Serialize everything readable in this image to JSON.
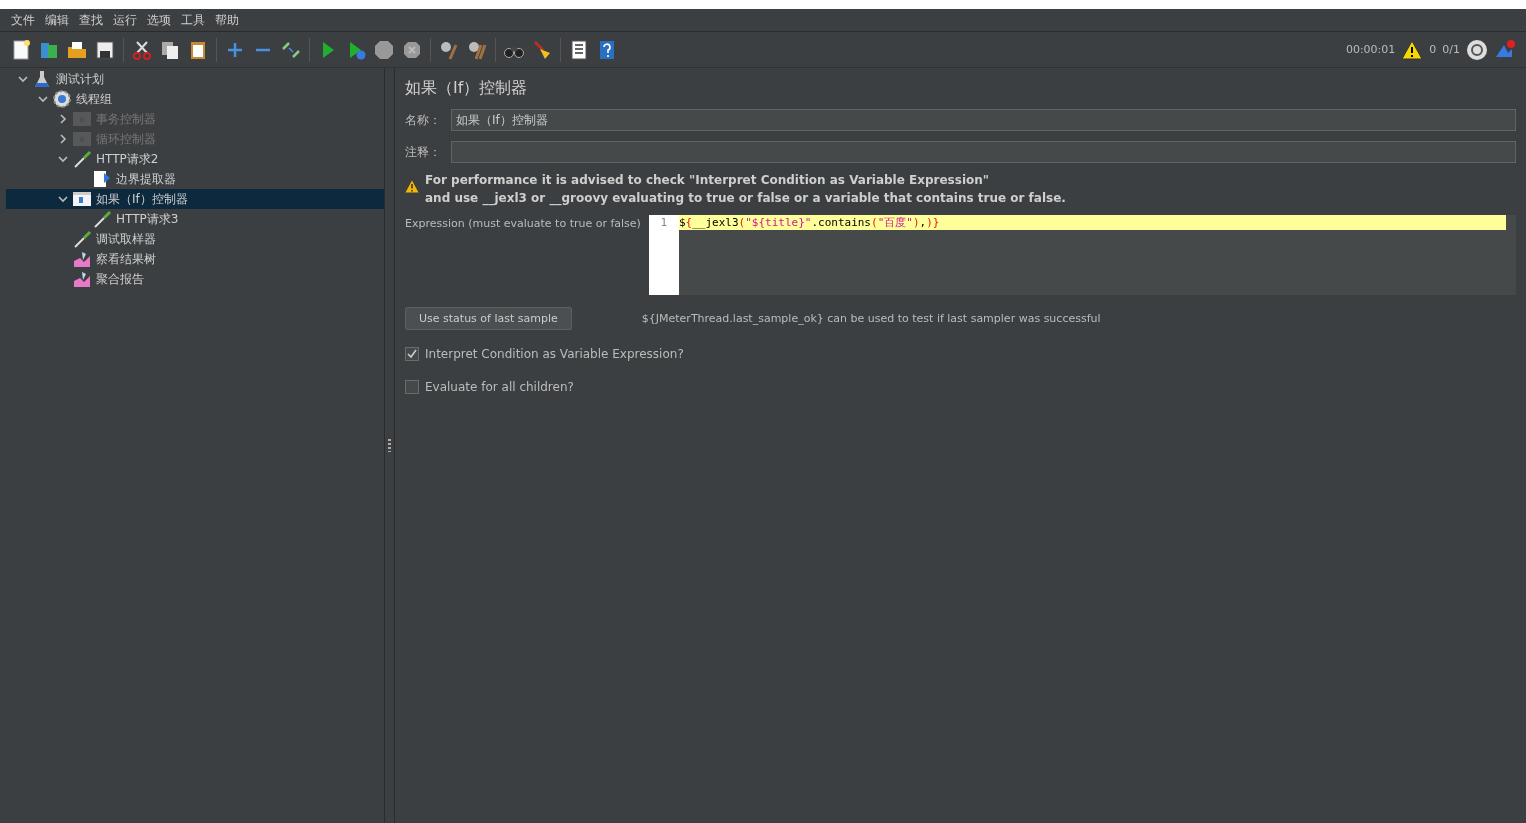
{
  "menu": [
    "文件",
    "编辑",
    "查找",
    "运行",
    "选项",
    "工具",
    "帮助"
  ],
  "status": {
    "timer": "00:00:01",
    "warnings": "0",
    "threads": "0/1"
  },
  "tree": [
    {
      "label": "测试计划",
      "kind": "plan",
      "expanded": true,
      "disabled": false,
      "selected": false,
      "children": [
        {
          "label": "线程组",
          "kind": "threadgroup",
          "expanded": true,
          "disabled": false,
          "selected": false,
          "children": [
            {
              "label": "事务控制器",
              "kind": "controller",
              "expanded": false,
              "disabled": true,
              "selected": false
            },
            {
              "label": "循环控制器",
              "kind": "controller",
              "expanded": false,
              "disabled": true,
              "selected": false
            },
            {
              "label": "HTTP请求2",
              "kind": "sampler",
              "expanded": true,
              "disabled": false,
              "selected": false,
              "children": [
                {
                  "label": "边界提取器",
                  "kind": "extractor",
                  "disabled": false,
                  "selected": false
                }
              ]
            },
            {
              "label": "如果（If）控制器",
              "kind": "ifcontroller",
              "expanded": true,
              "disabled": false,
              "selected": true,
              "children": [
                {
                  "label": "HTTP请求3",
                  "kind": "sampler",
                  "disabled": false,
                  "selected": false
                }
              ]
            },
            {
              "label": "调试取样器",
              "kind": "sampler",
              "disabled": false,
              "selected": false
            },
            {
              "label": "察看结果树",
              "kind": "listener",
              "disabled": false,
              "selected": false
            },
            {
              "label": "聚合报告",
              "kind": "listener",
              "disabled": false,
              "selected": false
            }
          ]
        }
      ]
    }
  ],
  "panel": {
    "title": "如果（If）控制器",
    "name_label": "名称：",
    "name_value": "如果（If）控制器",
    "comment_label": "注释：",
    "warning": [
      "For performance it is advised to check \"Interpret Condition as Variable Expression\"",
      "and use __jexl3 or __groovy evaluating to true or false or a variable that contains true or false."
    ],
    "expression_label": "Expression (must evaluate to true or false)",
    "line_number": "1",
    "code": [
      {
        "text": "$",
        "kind": "plain"
      },
      {
        "text": "{",
        "kind": "brace"
      },
      {
        "text": "__jexl3",
        "kind": "plain"
      },
      {
        "text": "(",
        "kind": "brace"
      },
      {
        "text": "\"${title}\"",
        "kind": "string"
      },
      {
        "text": ".contains",
        "kind": "plain"
      },
      {
        "text": "(",
        "kind": "brace"
      },
      {
        "text": "\"百度\"",
        "kind": "string"
      },
      {
        "text": ")",
        "kind": "brace"
      },
      {
        "text": ",",
        "kind": "plain"
      },
      {
        "text": ")}",
        "kind": "brace"
      }
    ],
    "button": "Use status of last sample",
    "hint": "${JMeterThread.last_sample_ok} can be used to test if last sampler was successful",
    "options": [
      {
        "label": "Interpret Condition as Variable Expression?",
        "checked": true
      },
      {
        "label": "Evaluate for all children?",
        "checked": false
      }
    ]
  }
}
